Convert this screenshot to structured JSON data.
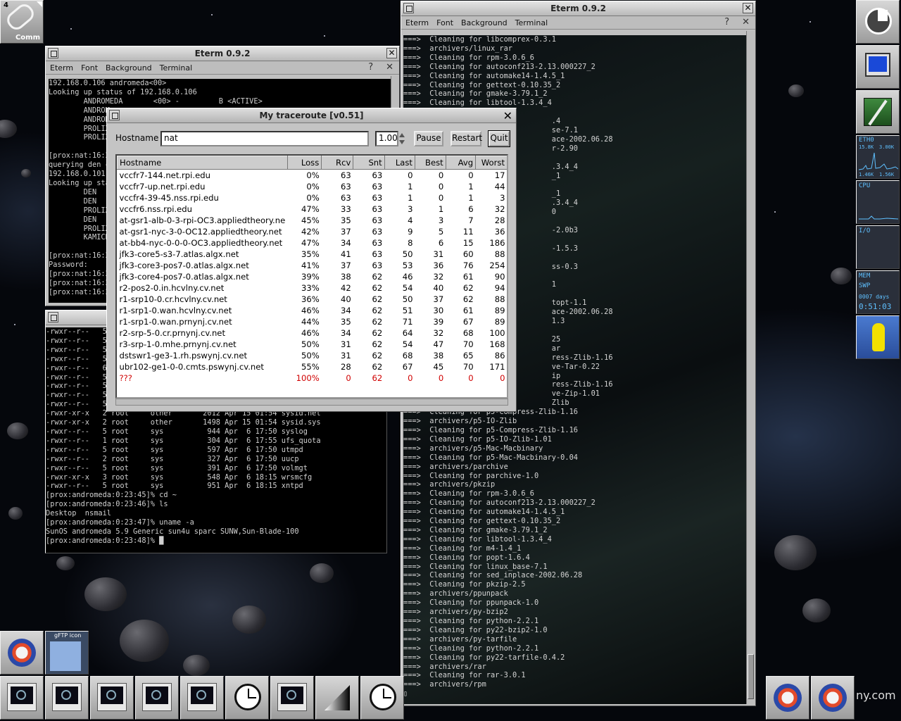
{
  "desktop": {
    "pager_label": "4",
    "comm_label": "Comm",
    "gftp_label": "gFTP icon",
    "watermark": "ny.com"
  },
  "eterm_left_top": {
    "title": "Eterm 0.9.2",
    "menus": [
      "Eterm",
      "Font",
      "Background",
      "Terminal"
    ],
    "help": "?",
    "close": "✕",
    "text": "192.168.0.106 andromeda<00>\nLooking up status of 192.168.0.106\n        ANDROMEDA       <00> -         B <ACTIVE>\n        ANDROM\n        ANDROM\n        PROLIX\n        PROLIX\n\n[prox:nat:16:2\nquerying den c\n192.168.0.101\nLooking up sta\n        DEN\n        DEN\n        PROLIX\n        DEN\n        PROLIX\n        KAMICH\n\n[prox:nat:16:2\nPassword:\n[prox:nat:16:2\n[prox:nat:16:2\n[prox:nat:16:2"
  },
  "eterm_left_bottom": {
    "text": "-rwxr--r--   5\n-rwxr--r--   5\n-rwxr--r--   5\n-rwxr--r--   5\n-rwxr--r--   6\n-rwxr--r--   5\n-rwxr--r--   5\n-rwxr--r--   5\n-rwxr--r--   5\n-rwxr-xr-x   2 root     other       2012 Apr 15 01:54 sysid.net\n-rwxr-xr-x   2 root     other       1498 Apr 15 01:54 sysid.sys\n-rwxr--r--   5 root     sys          944 Apr  6 17:50 syslog\n-rwxr--r--   1 root     sys          304 Apr  6 17:55 ufs_quota\n-rwxr--r--   5 root     sys          597 Apr  6 17:50 utmpd\n-rwxr--r--   2 root     sys          327 Apr  6 17:50 uucp\n-rwxr--r--   5 root     sys          391 Apr  6 17:50 volmgt\n-rwxr-xr-x   3 root     sys          548 Apr  6 18:15 wrsmcfg\n-rwxr--r--   5 root     sys          951 Apr  6 18:15 xntpd\n[prox:andromeda:0:23:45]% cd ~\n[prox:andromeda:0:23:46]% ls\nDesktop  nsmail\n[prox:andromeda:0:23:47]% uname -a\nSunOS andromeda 5.9 Generic sun4u sparc SUNW,Sun-Blade-100\n[prox:andromeda:0:23:48]% █"
  },
  "eterm_right": {
    "title": "Eterm 0.9.2",
    "menus": [
      "Eterm",
      "Font",
      "Background",
      "Terminal"
    ],
    "help": "?",
    "close": "✕",
    "text": "===>  Cleaning for libcomprex-0.3.1\n===>  archivers/linux_rar\n===>  Cleaning for rpm-3.0.6_6\n===>  Cleaning for autoconf213-2.13.000227_2\n===>  Cleaning for automake14-1.4.5_1\n===>  Cleaning for gettext-0.10.35_2\n===>  Cleaning for gmake-3.79.1_2\n===>  Cleaning for libtool-1.3.4_4\n===>\n===>                              .4\n===>                              se-7.1\n===>                              ace-2002.06.28\n===>                              r-2.90\n===>\n===>                              .3.4_4\n===>                              _1\n===>\n===>                              _1\n===>                              .3.4_4\n===>                              0\n===>\n===>                              -2.0b3\n===>\n===>                              -1.5.3\n===>\n===>                              ss-0.3\n===>\n===>                              1\n===>\n===>                              topt-1.1\n===>                              ace-2002.06.28\n===>                              1.3\n===>\n===>                              25\n===>                              ar\n===>                              ress-Zlib-1.16\n===>                              ve-Tar-0.22\n===>                              ip\n===>                              ress-Zlib-1.16\n===>                              ve-Zip-1.01\n===>                              Zlib\n===>  Cleaning for p5-Compress-Zlib-1.16\n===>  archivers/p5-IO-Zlib\n===>  Cleaning for p5-Compress-Zlib-1.16\n===>  Cleaning for p5-IO-Zlib-1.01\n===>  archivers/p5-Mac-Macbinary\n===>  Cleaning for p5-Mac-Macbinary-0.04\n===>  archivers/parchive\n===>  Cleaning for parchive-1.0\n===>  archivers/pkzip\n===>  Cleaning for rpm-3.0.6_6\n===>  Cleaning for autoconf213-2.13.000227_2\n===>  Cleaning for automake14-1.4.5_1\n===>  Cleaning for gettext-0.10.35_2\n===>  Cleaning for gmake-3.79.1_2\n===>  Cleaning for libtool-1.3.4_4\n===>  Cleaning for m4-1.4_1\n===>  Cleaning for popt-1.6.4\n===>  Cleaning for linux_base-7.1\n===>  Cleaning for sed_inplace-2002.06.28\n===>  Cleaning for pkzip-2.5\n===>  archivers/ppunpack\n===>  Cleaning for ppunpack-1.0\n===>  archivers/py-bzip2\n===>  Cleaning for python-2.2.1\n===>  Cleaning for py22-bzip2-1.0\n===>  archivers/py-tarfile\n===>  Cleaning for python-2.2.1\n===>  Cleaning for py22-tarfile-0.4.2\n===>  archivers/rar\n===>  Cleaning for rar-3.0.1\n===>  archivers/rpm\n▯"
  },
  "traceroute": {
    "title": "My traceroute  [v0.51]",
    "hostname_label": "Hostname",
    "hostname_value": "nat",
    "interval_value": "1.00",
    "pause": "Pause",
    "restart": "Restart",
    "quit": "Quit",
    "columns": [
      "Hostname",
      "Loss",
      "Rcv",
      "Snt",
      "Last",
      "Best",
      "Avg",
      "Worst"
    ],
    "rows": [
      [
        "vccfr7-144.net.rpi.edu",
        "0%",
        "63",
        "63",
        "0",
        "0",
        "0",
        "17"
      ],
      [
        "vccfr7-up.net.rpi.edu",
        "0%",
        "63",
        "63",
        "1",
        "0",
        "1",
        "44"
      ],
      [
        "vccfr4-39-45.nss.rpi.edu",
        "0%",
        "63",
        "63",
        "1",
        "0",
        "1",
        "3"
      ],
      [
        "vccfr6.nss.rpi.edu",
        "47%",
        "33",
        "63",
        "3",
        "1",
        "6",
        "32"
      ],
      [
        "at-gsr1-alb-0-3-rpi-OC3.appliedtheory.ne",
        "45%",
        "35",
        "63",
        "4",
        "3",
        "7",
        "28"
      ],
      [
        "at-gsr1-nyc-3-0-OC12.appliedtheory.net",
        "42%",
        "37",
        "63",
        "9",
        "5",
        "11",
        "36"
      ],
      [
        "at-bb4-nyc-0-0-0-OC3.appliedtheory.net",
        "47%",
        "34",
        "63",
        "8",
        "6",
        "15",
        "186"
      ],
      [
        "jfk3-core5-s3-7.atlas.algx.net",
        "35%",
        "41",
        "63",
        "50",
        "31",
        "60",
        "88"
      ],
      [
        "jfk3-core3-pos7-0.atlas.algx.net",
        "41%",
        "37",
        "63",
        "53",
        "36",
        "76",
        "254"
      ],
      [
        "jfk3-core4-pos7-0.atlas.algx.net",
        "39%",
        "38",
        "62",
        "46",
        "32",
        "61",
        "90"
      ],
      [
        "r2-pos2-0.in.hcvlny.cv.net",
        "33%",
        "42",
        "62",
        "54",
        "40",
        "62",
        "94"
      ],
      [
        "r1-srp10-0.cr.hcvlny.cv.net",
        "36%",
        "40",
        "62",
        "50",
        "37",
        "62",
        "88"
      ],
      [
        "r1-srp1-0.wan.hcvlny.cv.net",
        "46%",
        "34",
        "62",
        "51",
        "30",
        "61",
        "89"
      ],
      [
        "r1-srp1-0.wan.prnynj.cv.net",
        "44%",
        "35",
        "62",
        "71",
        "39",
        "67",
        "89"
      ],
      [
        "r2-srp-5-0.cr.prnynj.cv.net",
        "46%",
        "34",
        "62",
        "64",
        "32",
        "68",
        "100"
      ],
      [
        "r3-srp-1-0.mhe.prnynj.cv.net",
        "50%",
        "31",
        "62",
        "54",
        "47",
        "70",
        "168"
      ],
      [
        "dstswr1-ge3-1.rh.pswynj.cv.net",
        "50%",
        "31",
        "62",
        "68",
        "38",
        "65",
        "86"
      ],
      [
        "ubr102-ge1-0-0.cmts.pswynj.cv.net",
        "55%",
        "28",
        "62",
        "67",
        "45",
        "70",
        "171"
      ],
      [
        "???",
        "100%",
        "0",
        "62",
        "0",
        "0",
        "0",
        "0"
      ]
    ],
    "error_color": "#d00000"
  },
  "monitors": {
    "net_label": "ETH0",
    "net_rates": [
      "15.8K",
      "3.00K",
      "1.46K",
      "1.56K"
    ],
    "cpu_label": "CPU",
    "io_label": "I/O",
    "mem_label": "MEM",
    "swp_label": "SWP",
    "uptime_days": "0007 days",
    "uptime_time": "0:51:03"
  },
  "taskbar": {
    "items": [
      "monitor-icon",
      "monitor-icon",
      "monitor-icon",
      "monitor-icon",
      "monitor-icon",
      "clock-icon",
      "monitor-icon",
      "gradient-icon",
      "clock-icon"
    ]
  }
}
